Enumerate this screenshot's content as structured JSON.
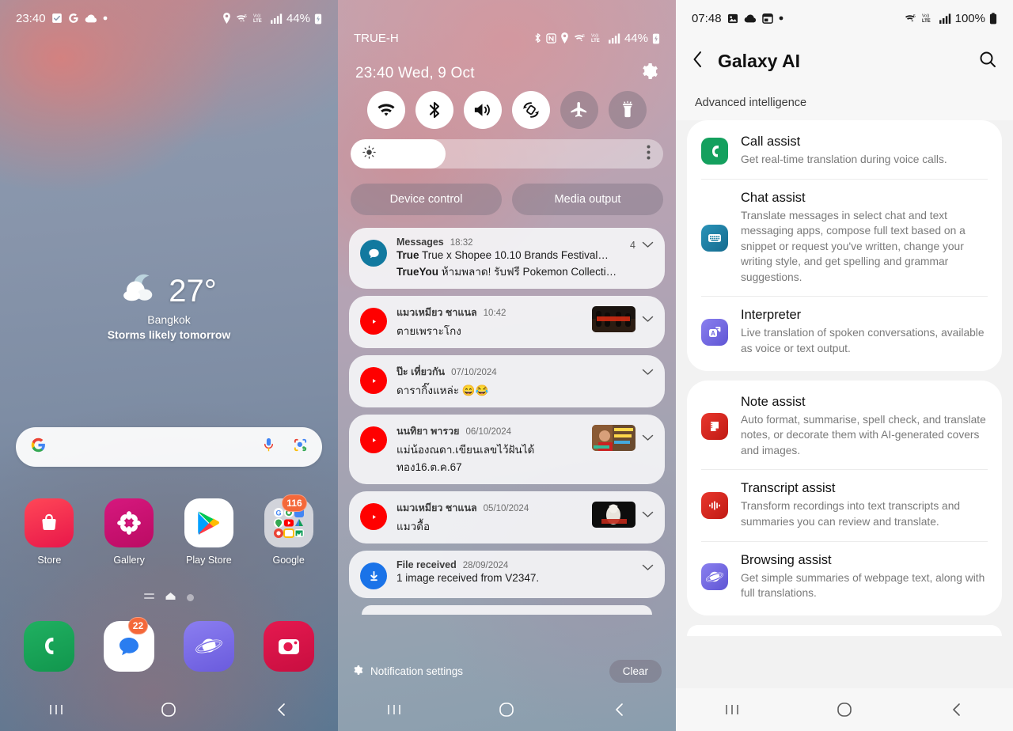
{
  "home": {
    "status": {
      "time": "23:40",
      "left_icons": [
        "checkbox-icon",
        "google-g-icon",
        "cloud-icon",
        "dot-icon"
      ],
      "right_icons": [
        "location-icon",
        "wifi-calling-icon",
        "volte-icon",
        "signal-icon"
      ],
      "battery": "44%",
      "battery_icon": "battery-charging-icon"
    },
    "weather": {
      "icon": "partly-cloudy-night-icon",
      "temp": "27°",
      "city": "Bangkok",
      "description": "Storms likely tomorrow"
    },
    "search": {
      "logo": "google-logo-icon",
      "placeholder": "",
      "value": "",
      "mic": "microphone-icon",
      "lens": "google-lens-icon"
    },
    "apps": [
      {
        "label": "Store",
        "icon": "shopping-bag-icon",
        "badge": ""
      },
      {
        "label": "Gallery",
        "icon": "flower-icon",
        "badge": ""
      },
      {
        "label": "Play Store",
        "icon": "play-triangle-icon",
        "badge": ""
      },
      {
        "label": "Google",
        "icon": "google-folder-icon",
        "badge": "116"
      }
    ],
    "dock": [
      {
        "label": "Phone",
        "icon": "phone-icon",
        "badge": ""
      },
      {
        "label": "Messages",
        "icon": "message-bubble-icon",
        "badge": "22"
      },
      {
        "label": "Internet",
        "icon": "samsung-internet-icon",
        "badge": ""
      },
      {
        "label": "Camera",
        "icon": "camera-icon",
        "badge": ""
      }
    ],
    "page_dots": [
      "widgets-page-dot",
      "home-page-dot",
      "page-dot"
    ],
    "nav": {
      "recents": "recents-icon",
      "home": "home-icon",
      "back": "back-icon"
    }
  },
  "quickpanel": {
    "status": {
      "carrier": "TRUE-H",
      "right_icons": [
        "bluetooth-icon",
        "nfc-icon",
        "location-icon",
        "wifi-calling-icon",
        "volte-icon",
        "signal-icon"
      ],
      "battery": "44%",
      "battery_icon": "battery-charging-icon"
    },
    "clock": "23:40  Wed, 9 Oct",
    "settings_icon": "gear-icon",
    "toggles": [
      {
        "name": "wifi-toggle",
        "icon": "wifi-icon",
        "state": "on"
      },
      {
        "name": "bluetooth-toggle",
        "icon": "bluetooth-icon",
        "state": "on"
      },
      {
        "name": "sound-toggle",
        "icon": "speaker-icon",
        "state": "on"
      },
      {
        "name": "auto-rotate-toggle",
        "icon": "rotate-icon",
        "state": "on"
      },
      {
        "name": "airplane-mode-toggle",
        "icon": "airplane-icon",
        "state": "off"
      },
      {
        "name": "flashlight-toggle",
        "icon": "flashlight-icon",
        "state": "off"
      }
    ],
    "brightness": {
      "icon": "brightness-icon",
      "percent": 30,
      "more_icon": "more-vertical-icon"
    },
    "buttons": {
      "device_control": "Device control",
      "media_output": "Media output"
    },
    "notifications": [
      {
        "app": "Messages",
        "time": "18:32",
        "count": "4",
        "icon": "messages-icon",
        "icon_color": "#12799f",
        "lines": [
          {
            "sender": "True",
            "text": "True x Shopee 10.10 Brands Festival…"
          },
          {
            "sender": "TrueYou",
            "text": "ห้ามพลาด! รับฟรี Pokemon Collecti…"
          }
        ],
        "thumb": ""
      },
      {
        "app": "แมวเหมียว ชาแนล",
        "time": "10:42",
        "count": "",
        "icon": "youtube-icon",
        "icon_color": "#ff0000",
        "lines": [
          {
            "sender": "",
            "text": "ตายเพราะโกง"
          }
        ],
        "thumb": "video-thumbnail"
      },
      {
        "app": "ป๊ะ เที่ยวกัน",
        "time": "07/10/2024",
        "count": "",
        "icon": "youtube-icon",
        "icon_color": "#ff0000",
        "lines": [
          {
            "sender": "",
            "text": "ดารากิ๊งแหล่ะ 😄😂"
          }
        ],
        "thumb": ""
      },
      {
        "app": "นนทิยา พารวย",
        "time": "06/10/2024",
        "count": "",
        "icon": "youtube-icon",
        "icon_color": "#ff0000",
        "lines": [
          {
            "sender": "",
            "text": "แม่น้องณดา.เขียนเลขไว้ฝันได้ทอง16.ต.ค.67"
          }
        ],
        "thumb": "video-thumbnail"
      },
      {
        "app": "แมวเหมียว ชาแนล",
        "time": "05/10/2024",
        "count": "",
        "icon": "youtube-icon",
        "icon_color": "#ff0000",
        "lines": [
          {
            "sender": "",
            "text": "แมวตื้อ"
          }
        ],
        "thumb": "video-thumbnail"
      },
      {
        "app": "File received",
        "time": "28/09/2024",
        "count": "",
        "icon": "download-icon",
        "icon_color": "#1a73e8",
        "lines": [
          {
            "sender": "",
            "text": "1 image received from V2347."
          }
        ],
        "thumb": ""
      }
    ],
    "footer": {
      "settings_label": "Notification settings",
      "settings_icon": "gear-icon",
      "clear_label": "Clear"
    },
    "nav": {
      "recents": "recents-icon",
      "home": "home-icon",
      "back": "back-icon"
    }
  },
  "galaxyai": {
    "status": {
      "time": "07:48",
      "left_icons": [
        "image-icon",
        "cloud-icon",
        "window-icon",
        "dot-icon"
      ],
      "right_icons": [
        "wifi-calling-icon",
        "volte-icon",
        "signal-icon"
      ],
      "battery": "100%",
      "battery_icon": "battery-full-icon"
    },
    "header": {
      "back_icon": "back-chevron-icon",
      "title": "Galaxy AI",
      "search_icon": "search-icon"
    },
    "subtitle": "Advanced intelligence",
    "groups": [
      {
        "items": [
          {
            "name": "Call assist",
            "desc": "Get real-time translation during voice calls.",
            "icon": "call-assist-icon",
            "color": "#14a05e"
          },
          {
            "name": "Chat assist",
            "desc": "Translate messages in select chat and text messaging apps, compose full text based on a snippet or request you've written, change your writing style, and get spelling and grammar suggestions.",
            "icon": "chat-assist-keyboard-icon",
            "color": "#1a7fa3"
          },
          {
            "name": "Interpreter",
            "desc": "Live translation of spoken conversations, available as voice or text output.",
            "icon": "interpreter-icon",
            "color": "#6d66dd"
          }
        ]
      },
      {
        "items": [
          {
            "name": "Note assist",
            "desc": "Auto format, summarise, spell check, and translate notes, or decorate them with AI-generated covers and images.",
            "icon": "note-assist-icon",
            "color": "#dc2a22"
          },
          {
            "name": "Transcript assist",
            "desc": "Transform recordings into text transcripts and summaries you can review and translate.",
            "icon": "transcript-assist-icon",
            "color": "#dc2a22"
          },
          {
            "name": "Browsing assist",
            "desc": "Get simple summaries of webpage text, along with full translations.",
            "icon": "browsing-assist-icon",
            "color": "#6d66dd"
          }
        ]
      }
    ],
    "nav": {
      "recents": "recents-icon",
      "home": "home-icon",
      "back": "back-icon"
    }
  },
  "colors": {
    "accent_orange": "#f4683a",
    "youtube_red": "#ff0000",
    "google_blue": "#1a73e8",
    "samsung_green": "#14a05e"
  }
}
